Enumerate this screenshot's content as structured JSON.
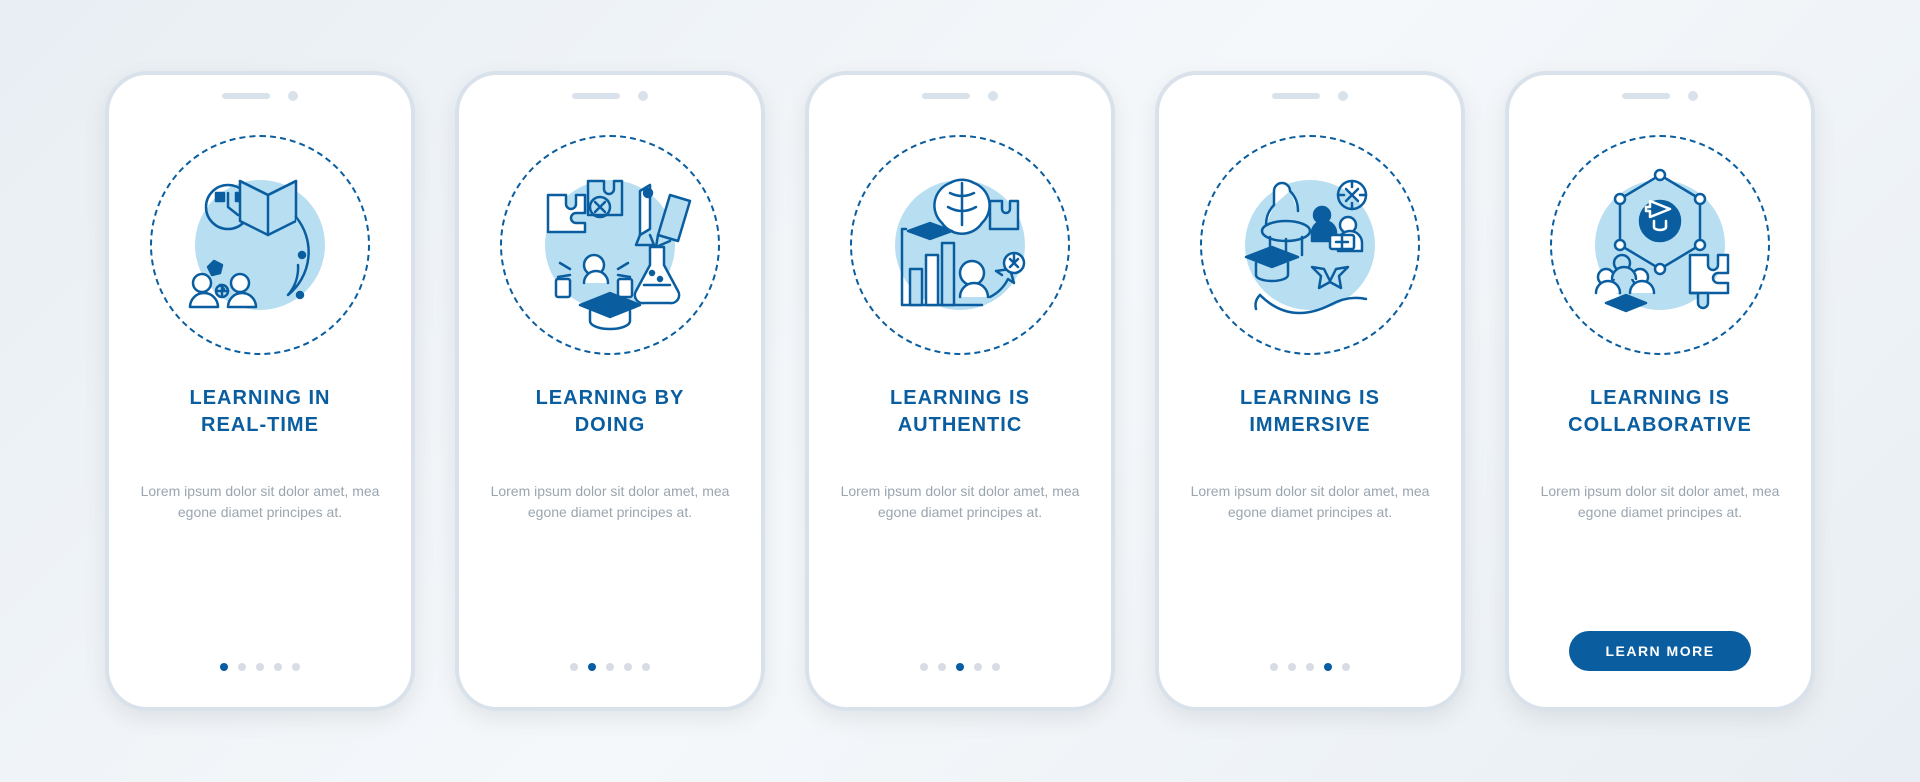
{
  "screens": [
    {
      "title": "LEARNING IN\nREAL-TIME",
      "description": "Lorem ipsum dolor sit dolor amet, mea egone diamet principes at.",
      "icon_name": "realtime-icon",
      "active_dot": 0,
      "has_button": false
    },
    {
      "title": "LEARNING BY\nDOING",
      "description": "Lorem ipsum dolor sit dolor amet, mea egone diamet principes at.",
      "icon_name": "doing-icon",
      "active_dot": 1,
      "has_button": false
    },
    {
      "title": "LEARNING IS\nAUTHENTIC",
      "description": "Lorem ipsum dolor sit dolor amet, mea egone diamet principes at.",
      "icon_name": "authentic-icon",
      "active_dot": 2,
      "has_button": false
    },
    {
      "title": "LEARNING IS\nIMMERSIVE",
      "description": "Lorem ipsum dolor sit dolor amet, mea egone diamet principes at.",
      "icon_name": "immersive-icon",
      "active_dot": 3,
      "has_button": false
    },
    {
      "title": "LEARNING IS\nCOLLABORATIVE",
      "description": "Lorem ipsum dolor sit dolor amet, mea egone diamet principes at.",
      "icon_name": "collaborative-icon",
      "active_dot": 4,
      "has_button": true
    }
  ],
  "button_label": "LEARN MORE",
  "dot_count": 5,
  "colors": {
    "primary": "#0a5ea0",
    "light_blue": "#b8def2",
    "grey": "#9aa5af"
  }
}
